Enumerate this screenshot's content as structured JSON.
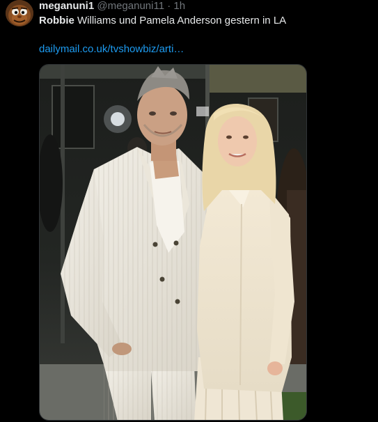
{
  "tweet": {
    "author_name": "meganuni1",
    "author_handle": "@meganuni11",
    "separator": "·",
    "timestamp": "1h",
    "text_bold": "Robbie",
    "text_rest": " Williams und Pamela Anderson gestern in LA",
    "link_text": "dailymail.co.uk/tvshowbiz/arti…"
  },
  "icons": {
    "avatar": "cartoon-face-avatar-icon"
  },
  "colors": {
    "background": "#000000",
    "text_primary": "#e7e9ea",
    "text_secondary": "#71767b",
    "link": "#1d9bf0"
  }
}
